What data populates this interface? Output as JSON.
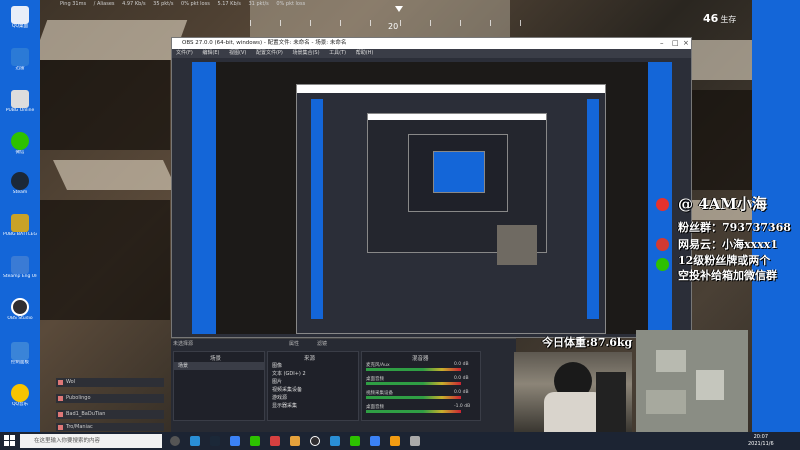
{
  "hud": {
    "ping": "Ping 31ms",
    "region": "/ Aliases",
    "down": "4.97 Kb/s",
    "down_pkt": "35 pkt/s",
    "loss1": "0% pkt loss",
    "up": "5.17 Kb/s",
    "up_pkt": "31 pkt/s",
    "loss2": "0% pkt loss"
  },
  "compass": {
    "heading": "20"
  },
  "game": {
    "alive_count": "46",
    "alive_label": "生存"
  },
  "overlay": {
    "name": "@ 4AM小海",
    "fans": "粉丝群：793737368",
    "netease": "网易云：小海xxxx1",
    "wechat_line1": "12级粉丝牌或两个",
    "wechat_line2": "空投补给箱加微信群",
    "weight": "今日体重:87.6kg"
  },
  "obs": {
    "title": "OBS 27.0.0 (64-bit, windows) - 配置文件: 未命名 - 场景: 未命名",
    "menu": [
      "文件(F)",
      "编辑(E)",
      "视图(V)",
      "配置文件(P)",
      "场景集合(S)",
      "工具(T)",
      "帮助(H)"
    ],
    "status_left": "未选择源",
    "status_props": "属性",
    "status_filters": "滤镜"
  },
  "dock": {
    "scenes_header": "场景",
    "sources_header": "来源",
    "mixer_header": "混音器",
    "scene_items": [
      "场景"
    ],
    "sources": [
      "图像",
      "文本 (GDI+) 2",
      "图片",
      "视频采集设备",
      "游戏源",
      "显示器采集"
    ],
    "mixer": [
      {
        "label": "麦克风/Aux",
        "db": "0.0 dB"
      },
      {
        "label": "桌面音频",
        "db": "0.0 dB"
      },
      {
        "label": "视频采集设备",
        "db": "0.0 dB"
      },
      {
        "label": "桌面音频",
        "db": "-1.0 dB"
      }
    ]
  },
  "apps": [
    {
      "label": "Wol"
    },
    {
      "label": "Pubolingo"
    },
    {
      "label": "Bad1_BaDuTian"
    },
    {
      "label": "Tro/Maniac"
    }
  ],
  "desktop": [
    {
      "label": "QQ桌面",
      "color": "#e8eef8"
    },
    {
      "label": "迅雷",
      "color": "#2b7ad6"
    },
    {
      "label": "PUBG Online",
      "color": "#dddddd"
    },
    {
      "label": "微信",
      "color": "#2dc100"
    },
    {
      "label": "Steam",
      "color": "#1b2838"
    },
    {
      "label": "PUBG BATTLEGROUNDS",
      "color": "#c9a227"
    },
    {
      "label": "Steamp Eng Ulutu",
      "color": "#3a7bd5"
    },
    {
      "label": "OBS Studio",
      "color": "#302e31"
    },
    {
      "label": "控制面板",
      "color": "#3a84d8"
    },
    {
      "label": "QQ音乐",
      "color": "#f7c400"
    }
  ],
  "taskbar": {
    "search_placeholder": "在这里输入你要搜索的内容",
    "time": "20:07",
    "date": "2021/11/6"
  },
  "colors": {
    "desktop_blue": "#1466d8",
    "obs_bg": "#2b2e38",
    "taskbar": "#1c2433"
  }
}
